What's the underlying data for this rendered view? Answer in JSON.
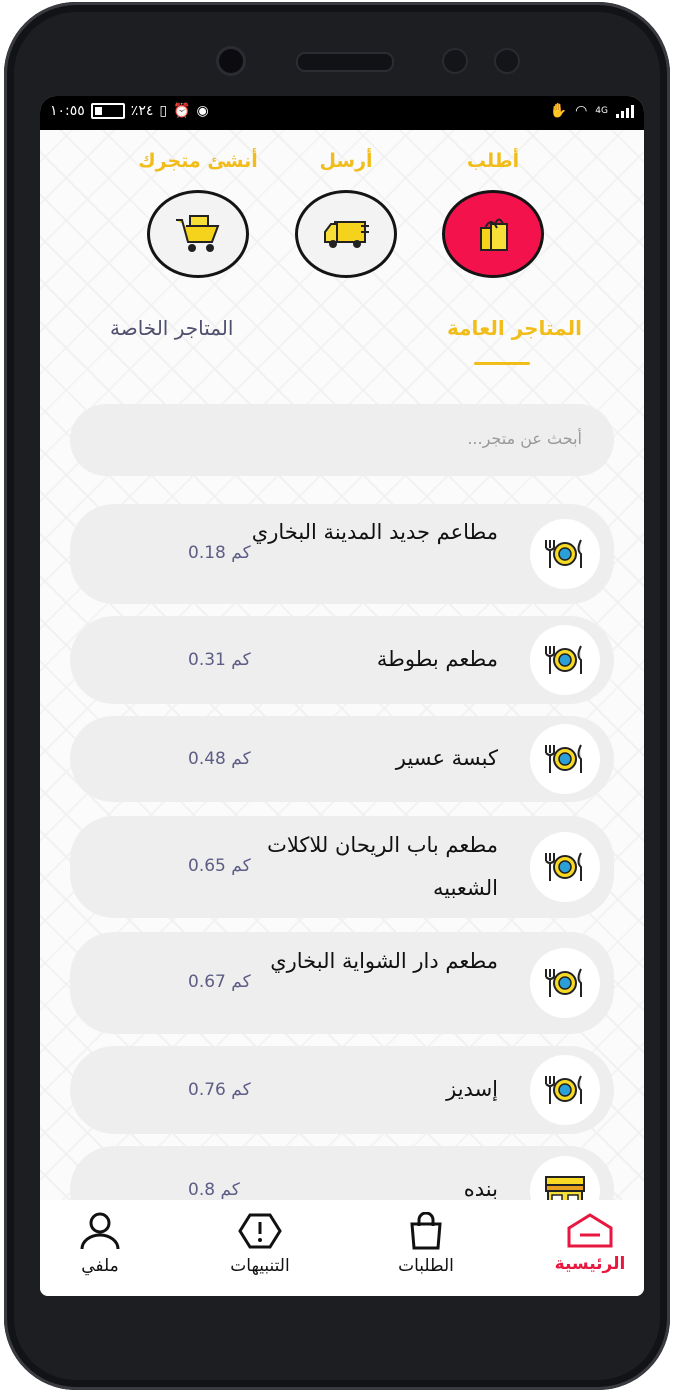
{
  "status_bar": {
    "time": "١٠:٥٥",
    "battery": "٪٢٤",
    "network": "4G"
  },
  "actions": [
    {
      "label": "أطلب",
      "icon": "shopping-bag-icon"
    },
    {
      "label": "أرسل",
      "icon": "delivery-truck-icon"
    },
    {
      "label": "أنشئ متجرك",
      "icon": "shopping-cart-icon"
    }
  ],
  "tabs": {
    "public": "المتاجر العامة",
    "private": "المتاجر الخاصة"
  },
  "search": {
    "placeholder": "أبحث عن متجر..."
  },
  "stores": [
    {
      "name": "مطاعم جديد المدينة البخاري",
      "distance": "0.18  كم",
      "icon": "restaurant-plate-icon"
    },
    {
      "name": "مطعم بطوطة",
      "distance": "0.31  كم",
      "icon": "restaurant-plate-icon"
    },
    {
      "name": "كبسة عسير",
      "distance": "0.48  كم",
      "icon": "restaurant-plate-icon"
    },
    {
      "name": "مطعم باب الريحان للاكلات الشعبيه",
      "distance": "0.65  كم",
      "icon": "restaurant-plate-icon"
    },
    {
      "name": "مطعم دار الشواية البخاري",
      "distance": "0.67  كم",
      "icon": "restaurant-plate-icon"
    },
    {
      "name": "إسديز",
      "distance": "0.76  كم",
      "icon": "restaurant-plate-icon"
    },
    {
      "name": "بنده",
      "distance": "0.8  كم",
      "icon": "storefront-icon"
    }
  ],
  "bottom_nav": [
    {
      "label": "الرئيسية",
      "icon": "home-icon"
    },
    {
      "label": "الطلبات",
      "icon": "bag-icon"
    },
    {
      "label": "التنبيهات",
      "icon": "alert-icon"
    },
    {
      "label": "ملفي",
      "icon": "user-icon"
    }
  ],
  "colors": {
    "accent": "#f0bd1a",
    "active": "#f4124d",
    "nav_active": "#e8173f",
    "card": "#eeeeee"
  }
}
